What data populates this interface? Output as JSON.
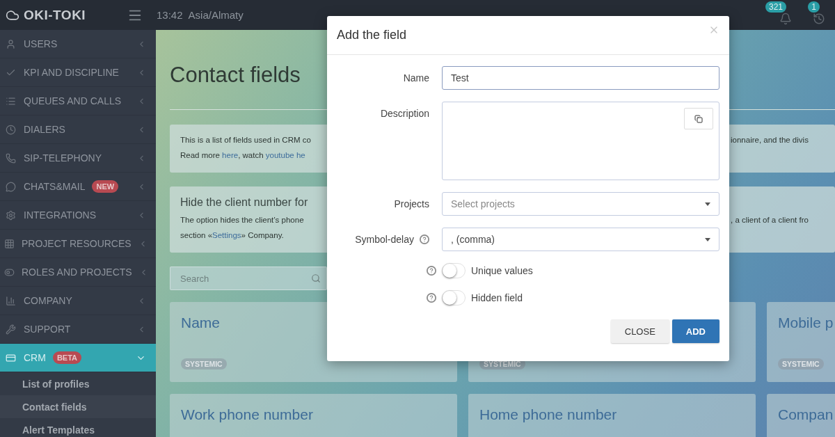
{
  "topbar": {
    "logo": "OKI-TOKI",
    "time": "13:42",
    "timezone": "Asia/Almaty",
    "notifications": {
      "count": "321"
    },
    "history": {
      "count": "1"
    }
  },
  "sidebar": {
    "items": [
      {
        "label": "USERS",
        "expanded": false,
        "selected": false
      },
      {
        "label": "KPI AND DISCIPLINE",
        "expanded": false,
        "selected": false
      },
      {
        "label": "QUEUES AND CALLS",
        "expanded": false,
        "selected": false
      },
      {
        "label": "DIALERS",
        "expanded": false,
        "selected": false
      },
      {
        "label": "SIP-TELEPHONY",
        "expanded": false,
        "selected": false
      },
      {
        "label": "CHATS&MAIL",
        "badge": "NEW",
        "expanded": false,
        "selected": false
      },
      {
        "label": "INTEGRATIONS",
        "expanded": false,
        "selected": false
      },
      {
        "label": "PROJECT RESOURCES",
        "expanded": false,
        "selected": false
      },
      {
        "label": "ROLES AND PROJECTS",
        "expanded": false,
        "selected": false
      },
      {
        "label": "COMPANY",
        "expanded": false,
        "selected": false
      },
      {
        "label": "SUPPORT",
        "expanded": false,
        "selected": false
      },
      {
        "label": "CRM",
        "badge": "BETA",
        "expanded": true,
        "selected": true,
        "children": [
          {
            "label": "List of profiles",
            "selected": false
          },
          {
            "label": "Contact fields",
            "selected": true
          },
          {
            "label": "Alert Templates",
            "selected": false
          }
        ]
      }
    ]
  },
  "page": {
    "title": "Contact fields",
    "info_cards": [
      {
        "lines": [
          {
            "left": [
              {
                "kind": "text",
                "text": "This is a list of fields used in CRM co"
              }
            ],
            "right": [
              {
                "kind": "text",
                "text": "ionnaire, and the divis"
              }
            ]
          },
          {
            "left": [
              {
                "kind": "text",
                "text": "Read more "
              },
              {
                "kind": "link",
                "text": "here"
              },
              {
                "kind": "text",
                "text": ", watch "
              },
              {
                "kind": "link",
                "text": "youtube he"
              }
            ]
          }
        ]
      },
      {
        "heading": "Hide the client number for",
        "lines": [
          {
            "left": [
              {
                "kind": "text",
                "text": "The option hides the client’s phone"
              }
            ],
            "right": [
              {
                "kind": "text",
                "text": ", a client of a client fro"
              }
            ]
          },
          {
            "left": [
              {
                "kind": "text",
                "text": "section «"
              },
              {
                "kind": "link",
                "text": "Settings"
              },
              {
                "kind": "text",
                "text": "» Company."
              }
            ]
          }
        ]
      }
    ],
    "search": {
      "placeholder": "Search"
    },
    "cards": [
      {
        "title": "Name",
        "badge": "SYSTEMIC"
      },
      {
        "badge": "SYSTEMIC"
      },
      {
        "title": "Mobile p",
        "badge": "SYSTEMIC"
      },
      {
        "title": "Work phone number"
      },
      {
        "title": "Home phone number"
      },
      {
        "title": "Compan"
      }
    ]
  },
  "modal": {
    "title": "Add the field",
    "fields": [
      {
        "kind": "text",
        "label": "Name",
        "value": "Test",
        "focused": true
      },
      {
        "kind": "textarea",
        "label": "Description",
        "focused": false
      },
      {
        "kind": "select",
        "label": "Projects",
        "placeholder": "Select projects",
        "focused": false
      },
      {
        "kind": "select",
        "label": "Symbol-delay",
        "value": ", (comma)",
        "focused": false,
        "help": true
      }
    ],
    "toggles": [
      {
        "label": "Unique values",
        "on": false
      },
      {
        "label": "Hidden field",
        "on": false
      }
    ],
    "buttons": [
      {
        "label": "CLOSE",
        "kind": "default"
      },
      {
        "label": "ADD",
        "kind": "primary"
      }
    ]
  }
}
